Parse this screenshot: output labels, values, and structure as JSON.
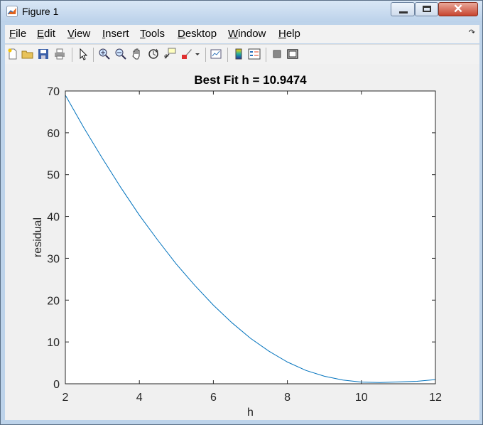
{
  "window": {
    "title": "Figure 1",
    "close_glyph": "✕"
  },
  "menu": [
    {
      "label": "File",
      "mnemonic": "F",
      "rest": "ile"
    },
    {
      "label": "Edit",
      "mnemonic": "E",
      "rest": "dit"
    },
    {
      "label": "View",
      "mnemonic": "V",
      "rest": "iew"
    },
    {
      "label": "Insert",
      "mnemonic": "I",
      "rest": "nsert"
    },
    {
      "label": "Tools",
      "mnemonic": "T",
      "rest": "ools"
    },
    {
      "label": "Desktop",
      "mnemonic": "D",
      "rest": "esktop"
    },
    {
      "label": "Window",
      "mnemonic": "W",
      "rest": "indow"
    },
    {
      "label": "Help",
      "mnemonic": "H",
      "rest": "elp"
    }
  ],
  "toolbar": {
    "icons": [
      "new-figure-icon",
      "open-file-icon",
      "save-icon",
      "print-icon",
      "edit-plot-arrow-icon",
      "zoom-in-icon",
      "zoom-out-icon",
      "pan-hand-icon",
      "rotate-3d-icon",
      "data-cursor-icon",
      "brush-icon",
      "dropdown-arrow-icon",
      "link-plot-icon",
      "colorbar-icon",
      "legend-icon",
      "hide-plot-tools-icon",
      "show-plot-tools-icon"
    ]
  },
  "chart_data": {
    "type": "line",
    "title": "Best Fit h = 10.9474",
    "xlabel": "h",
    "ylabel": "residual",
    "xlim": [
      2,
      12
    ],
    "ylim": [
      0,
      70
    ],
    "xticks": [
      2,
      4,
      6,
      8,
      10,
      12
    ],
    "yticks": [
      0,
      10,
      20,
      30,
      40,
      50,
      60,
      70
    ],
    "grid": false,
    "line_color": "#0072bd",
    "series": [
      {
        "x": [
          2,
          2.5,
          3,
          3.5,
          4,
          4.5,
          5,
          5.5,
          6,
          6.5,
          7,
          7.5,
          8,
          8.5,
          9,
          9.5,
          10,
          10.5,
          11,
          11.5,
          12
        ],
        "y": [
          69.0,
          61.2,
          53.9,
          46.9,
          40.3,
          34.3,
          28.6,
          23.5,
          18.8,
          14.6,
          10.9,
          7.8,
          5.2,
          3.2,
          1.8,
          0.9,
          0.4,
          0.3,
          0.45,
          0.6,
          1.0
        ]
      }
    ]
  }
}
